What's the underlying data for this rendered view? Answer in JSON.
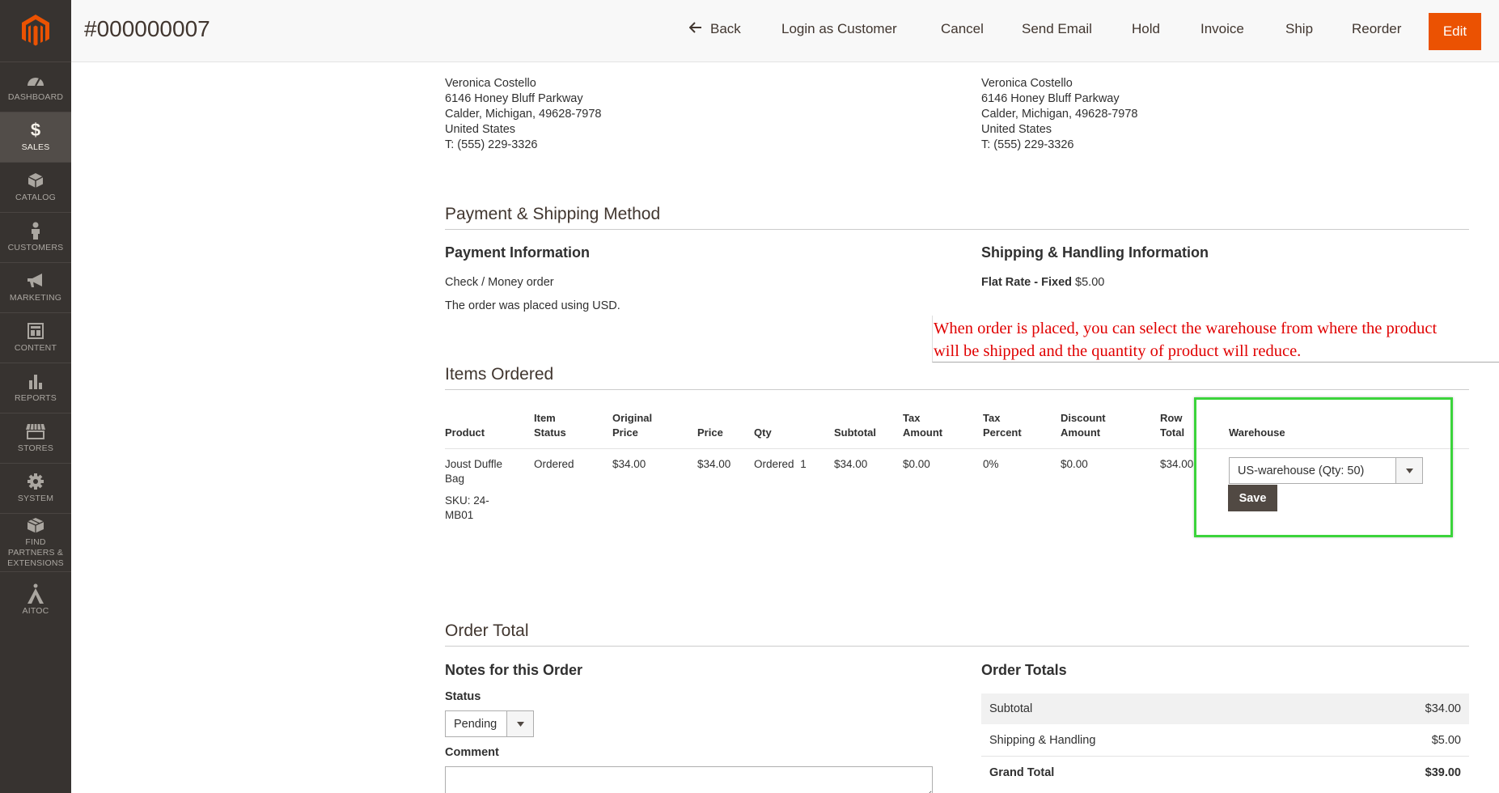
{
  "sidebar": {
    "items": [
      {
        "label": "DASHBOARD",
        "icon": "dashboard-icon"
      },
      {
        "label": "SALES",
        "icon": "dollar-icon",
        "active": true
      },
      {
        "label": "CATALOG",
        "icon": "cube-icon"
      },
      {
        "label": "CUSTOMERS",
        "icon": "person-icon"
      },
      {
        "label": "MARKETING",
        "icon": "megaphone-icon"
      },
      {
        "label": "CONTENT",
        "icon": "layout-icon"
      },
      {
        "label": "REPORTS",
        "icon": "bar-chart-icon"
      },
      {
        "label": "STORES",
        "icon": "store-icon"
      },
      {
        "label": "SYSTEM",
        "icon": "gear-icon"
      },
      {
        "label": "FIND PARTNERS & EXTENSIONS",
        "icon": "box-icon"
      },
      {
        "label": "AITOC",
        "icon": "aitoc-icon"
      }
    ]
  },
  "header": {
    "order_number": "#000000007",
    "buttons": {
      "back": "Back",
      "login_as_customer": "Login as Customer",
      "cancel": "Cancel",
      "send_email": "Send Email",
      "hold": "Hold",
      "invoice": "Invoice",
      "ship": "Ship",
      "reorder": "Reorder",
      "edit": "Edit"
    },
    "accent_color": "#eb5202"
  },
  "billing_address": [
    "Veronica Costello",
    "6146 Honey Bluff Parkway",
    "Calder, Michigan, 49628-7978",
    "United States",
    "T: (555) 229-3326"
  ],
  "shipping_address": [
    "Veronica Costello",
    "6146 Honey Bluff Parkway",
    "Calder, Michigan, 49628-7978",
    "United States",
    "T: (555) 229-3326"
  ],
  "payment_shipping": {
    "section_title": "Payment & Shipping Method",
    "payment_title": "Payment Information",
    "payment_method": "Check / Money order",
    "payment_note": "The order was placed using USD.",
    "shipping_title": "Shipping & Handling Information",
    "shipping_method": "Flat Rate - Fixed",
    "shipping_price": "$5.00"
  },
  "annotation": {
    "line1": "When order is placed, you can select the warehouse from where the product",
    "line2": "will be shipped and the quantity of product will reduce.",
    "color": "#e00000"
  },
  "items_ordered": {
    "section_title": "Items Ordered",
    "headers": {
      "product": "Product",
      "item_status_1": "Item",
      "item_status_2": "Status",
      "original_price_1": "Original",
      "original_price_2": "Price",
      "price": "Price",
      "qty": "Qty",
      "subtotal": "Subtotal",
      "tax_amount_1": "Tax",
      "tax_amount_2": "Amount",
      "tax_percent_1": "Tax",
      "tax_percent_2": "Percent",
      "discount_amount_1": "Discount",
      "discount_amount_2": "Amount",
      "row_total_1": "Row",
      "row_total_2": "Total",
      "warehouse": "Warehouse"
    },
    "row": {
      "product_name_1": "Joust Duffle",
      "product_name_2": "Bag",
      "sku_1": "SKU: 24-",
      "sku_2": "MB01",
      "item_status": "Ordered",
      "original_price": "$34.00",
      "price": "$34.00",
      "qty_label": "Ordered",
      "qty_value": "1",
      "subtotal": "$34.00",
      "tax_amount": "$0.00",
      "tax_percent": "0%",
      "discount_amount": "$0.00",
      "row_total": "$34.00",
      "warehouse_selected": "US-warehouse (Qty: 50)",
      "save_label": "Save"
    },
    "highlight_color": "#3bd43b"
  },
  "order_total": {
    "section_title": "Order Total",
    "notes_title": "Notes for this Order",
    "status_label": "Status",
    "status_value": "Pending",
    "comment_label": "Comment",
    "totals_title": "Order Totals",
    "subtotal_label": "Subtotal",
    "subtotal_value": "$34.00",
    "shipping_label": "Shipping & Handling",
    "shipping_value": "$5.00",
    "grand_total_label": "Grand Total",
    "grand_total_value": "$39.00"
  }
}
